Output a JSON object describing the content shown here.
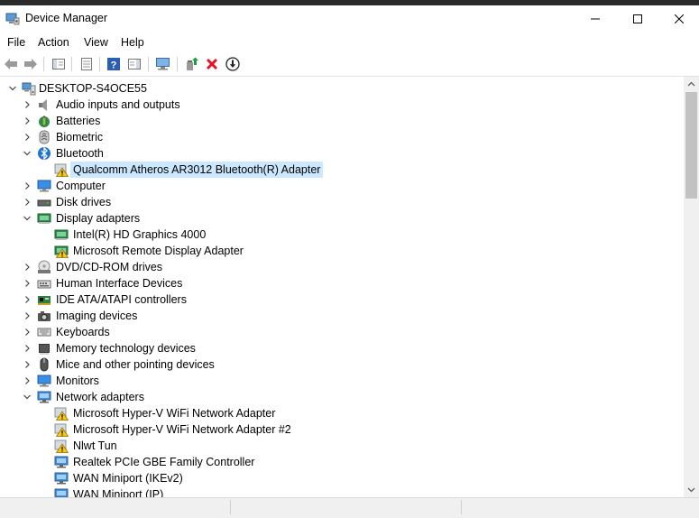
{
  "window": {
    "title": "Device Manager",
    "controls": [
      "minimize-icon",
      "maximize-icon",
      "close-icon"
    ]
  },
  "menu": [
    "File",
    "Action",
    "View",
    "Help"
  ],
  "toolbar": [
    "back-arrow-icon",
    "forward-arrow-icon",
    "show-hide-console-tree-icon",
    "properties-icon",
    "help-icon",
    "action-pane-icon",
    "scan-hardware-changes-icon",
    "update-driver-icon",
    "uninstall-device-icon",
    "disable-device-icon"
  ],
  "tree": {
    "root": "DESKTOP-S4OCE55",
    "items": [
      {
        "label": "Audio inputs and outputs",
        "level": 1,
        "state": "collapsed",
        "icon": "speaker-icon"
      },
      {
        "label": "Batteries",
        "level": 1,
        "state": "collapsed",
        "icon": "battery-icon"
      },
      {
        "label": "Biometric",
        "level": 1,
        "state": "collapsed",
        "icon": "fingerprint-icon"
      },
      {
        "label": "Bluetooth",
        "level": 1,
        "state": "expanded",
        "icon": "bluetooth-icon"
      },
      {
        "label": "Qualcomm Atheros AR3012 Bluetooth(R) Adapter",
        "level": 2,
        "state": "leaf",
        "icon": "warning-icon",
        "selected": true
      },
      {
        "label": "Computer",
        "level": 1,
        "state": "collapsed",
        "icon": "computer-icon"
      },
      {
        "label": "Disk drives",
        "level": 1,
        "state": "collapsed",
        "icon": "disk-drive-icon"
      },
      {
        "label": "Display adapters",
        "level": 1,
        "state": "expanded",
        "icon": "display-adapter-icon"
      },
      {
        "label": "Intel(R) HD Graphics 4000",
        "level": 2,
        "state": "leaf",
        "icon": "display-adapter-icon"
      },
      {
        "label": "Microsoft Remote Display Adapter",
        "level": 2,
        "state": "leaf",
        "icon": "display-adapter-warning-icon"
      },
      {
        "label": "DVD/CD-ROM drives",
        "level": 1,
        "state": "collapsed",
        "icon": "dvd-drive-icon"
      },
      {
        "label": "Human Interface Devices",
        "level": 1,
        "state": "collapsed",
        "icon": "hid-icon"
      },
      {
        "label": "IDE ATA/ATAPI controllers",
        "level": 1,
        "state": "collapsed",
        "icon": "ide-controller-icon"
      },
      {
        "label": "Imaging devices",
        "level": 1,
        "state": "collapsed",
        "icon": "camera-icon"
      },
      {
        "label": "Keyboards",
        "level": 1,
        "state": "collapsed",
        "icon": "keyboard-icon"
      },
      {
        "label": "Memory technology devices",
        "level": 1,
        "state": "collapsed",
        "icon": "memory-icon"
      },
      {
        "label": "Mice and other pointing devices",
        "level": 1,
        "state": "collapsed",
        "icon": "mouse-icon"
      },
      {
        "label": "Monitors",
        "level": 1,
        "state": "collapsed",
        "icon": "monitor-icon"
      },
      {
        "label": "Network adapters",
        "level": 1,
        "state": "expanded",
        "icon": "network-adapter-icon"
      },
      {
        "label": "Microsoft Hyper-V WiFi Network Adapter",
        "level": 2,
        "state": "leaf",
        "icon": "warning-icon"
      },
      {
        "label": "Microsoft Hyper-V WiFi Network Adapter #2",
        "level": 2,
        "state": "leaf",
        "icon": "warning-icon"
      },
      {
        "label": "Nlwt Tun",
        "level": 2,
        "state": "leaf",
        "icon": "warning-icon"
      },
      {
        "label": "Realtek PCIe GBE Family Controller",
        "level": 2,
        "state": "leaf",
        "icon": "network-adapter-icon"
      },
      {
        "label": "WAN Miniport (IKEv2)",
        "level": 2,
        "state": "leaf",
        "icon": "network-adapter-icon"
      },
      {
        "label": "WAN Miniport (IP)",
        "level": 2,
        "state": "leaf",
        "icon": "network-adapter-icon"
      }
    ]
  },
  "colors": {
    "selection": "#cce8ff",
    "warning": "#f5c518",
    "accent": "#0078d7",
    "uninstall": "#e81123"
  }
}
